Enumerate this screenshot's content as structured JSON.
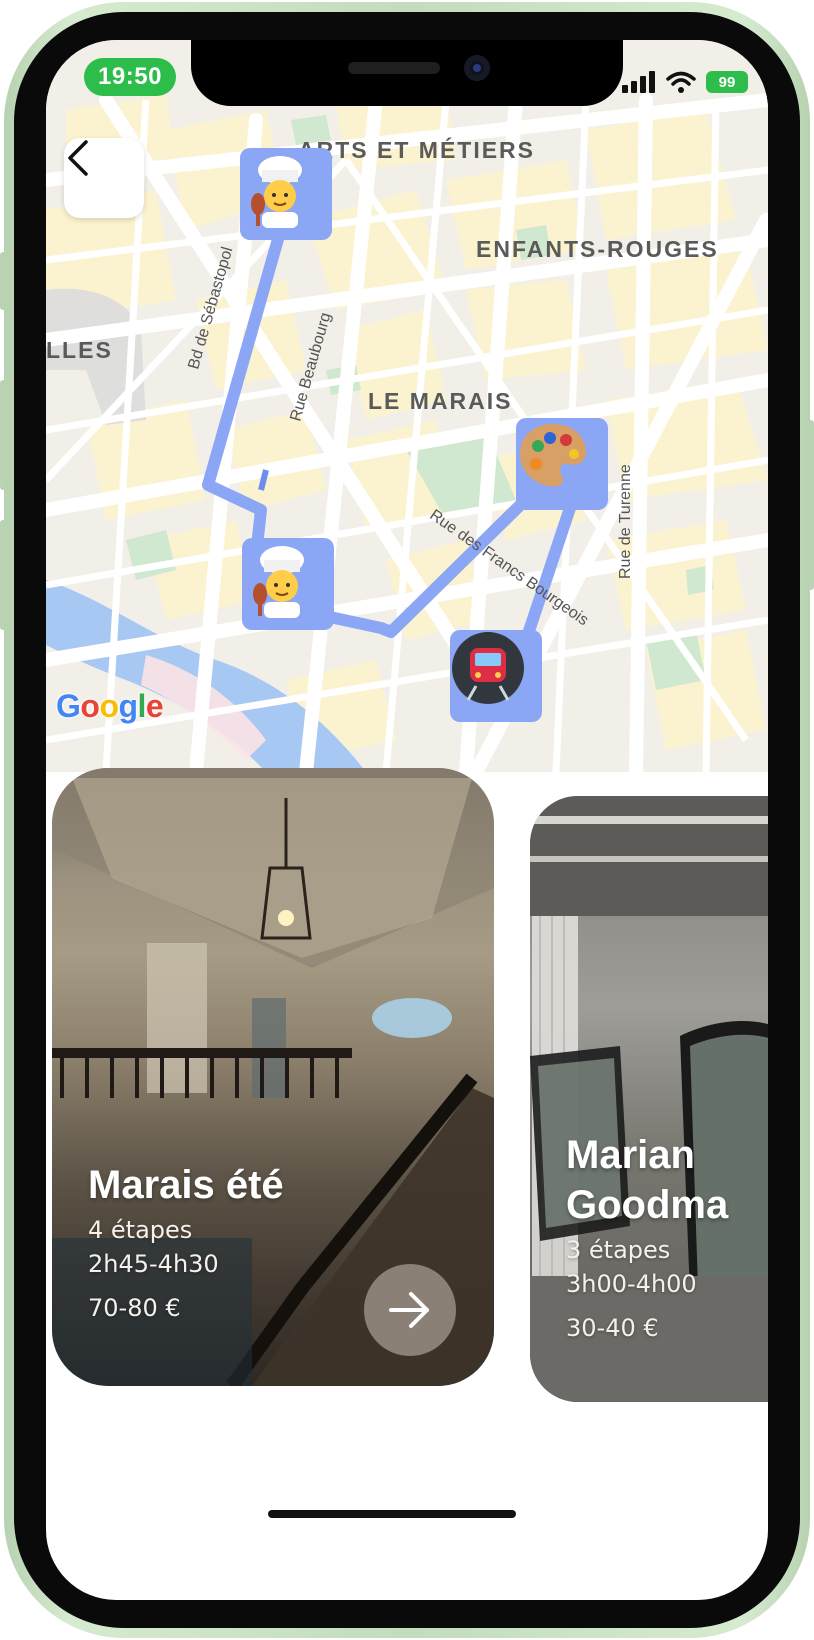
{
  "status_bar": {
    "time": "19:50",
    "battery": "99",
    "icons": [
      "signal-icon",
      "wifi-icon",
      "battery-icon"
    ],
    "accent_color": "#2dbd4a"
  },
  "map": {
    "provider_logo": "Google",
    "back_icon": "chevron-left-icon",
    "district_labels": [
      "ARTS ET MÉTIERS",
      "ENFANTS-ROUGES",
      "LLES",
      "LE MARAIS"
    ],
    "street_labels": [
      "Bd de Sébastopol",
      "Rue Beaubourg",
      "Rue des Francs Bourgeois",
      "Rue de Turenne"
    ],
    "route_color": "#8ba6f4",
    "markers": [
      {
        "icon": "chef-icon",
        "type": "restaurant"
      },
      {
        "icon": "chef-icon",
        "type": "restaurant"
      },
      {
        "icon": "palette-icon",
        "type": "museum"
      },
      {
        "icon": "metro-icon",
        "type": "station"
      }
    ]
  },
  "tours": [
    {
      "title": "Marais été",
      "steps": "4 étapes",
      "duration": "2h45-4h30",
      "price": "70-80 €",
      "action_icon": "arrow-right-icon"
    },
    {
      "title": "Marian\nGoodma",
      "steps": "3 étapes",
      "duration": "3h00-4h00",
      "price": "30-40 €"
    }
  ]
}
